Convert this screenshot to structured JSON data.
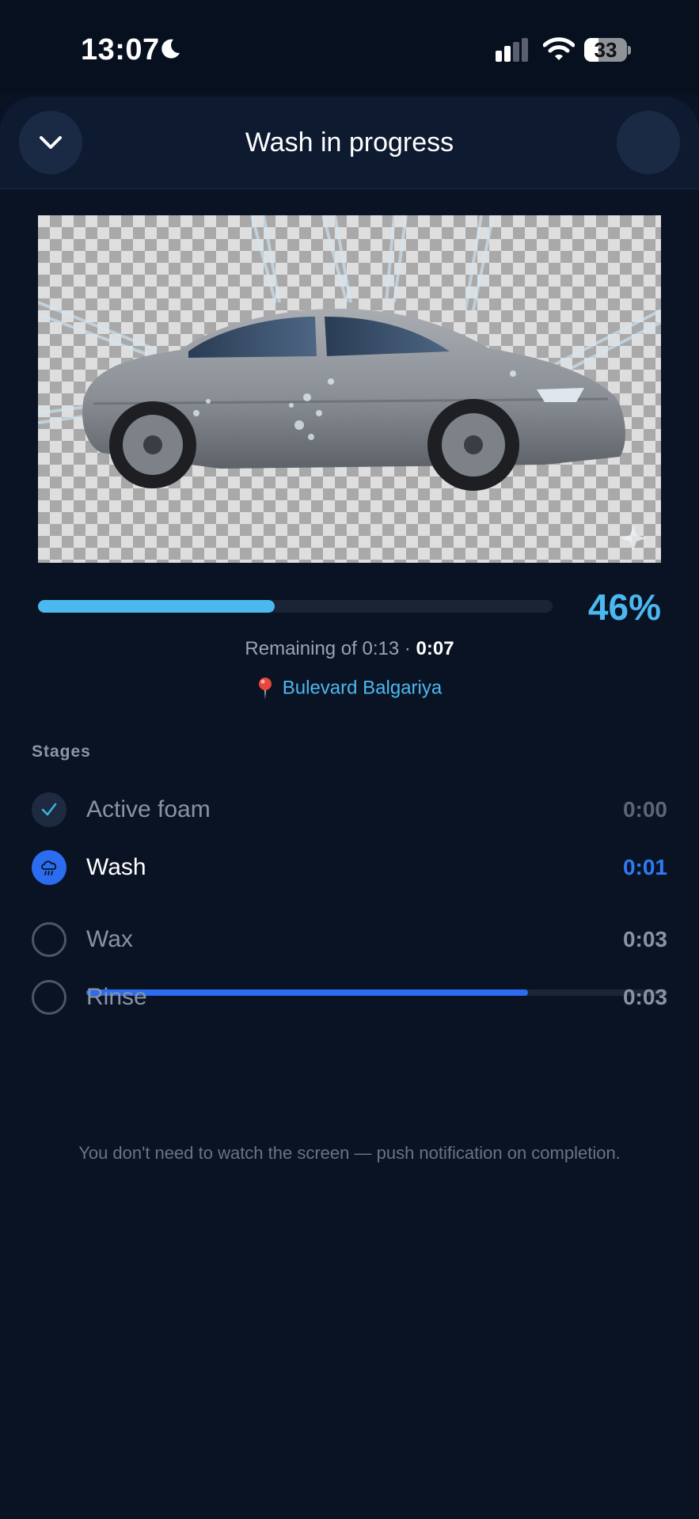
{
  "status_bar": {
    "time": "13:07",
    "battery": "33",
    "icons": [
      "moon-icon",
      "signal-icon",
      "wifi-icon",
      "battery-icon"
    ]
  },
  "header": {
    "title": "Wash in progress",
    "back_icon": "chevron-down-icon"
  },
  "progress": {
    "fraction": 0.46,
    "percent_label": "46%"
  },
  "remaining": {
    "prefix": "Remaining of 0:13 · ",
    "value": "0:07"
  },
  "location": {
    "icon": "pin-icon",
    "label": "Bulevard Balgariya"
  },
  "stages": {
    "heading": "Stages",
    "items": [
      {
        "name": "Active foam",
        "duration": "0:00",
        "state": "done",
        "icon": "check-icon"
      },
      {
        "name": "Wash",
        "duration": "0:01",
        "state": "active",
        "icon": "rain-cloud-icon",
        "progress_fraction": 0.76
      },
      {
        "name": "Wax",
        "duration": "0:03",
        "state": "pending"
      },
      {
        "name": "Rinse",
        "duration": "0:03",
        "state": "pending"
      }
    ]
  },
  "note": "You don't need to watch the screen — push notification on completion.",
  "colors": {
    "background": "#0a1324",
    "accent": "#4bb8f0",
    "active": "#2b6cf0"
  }
}
